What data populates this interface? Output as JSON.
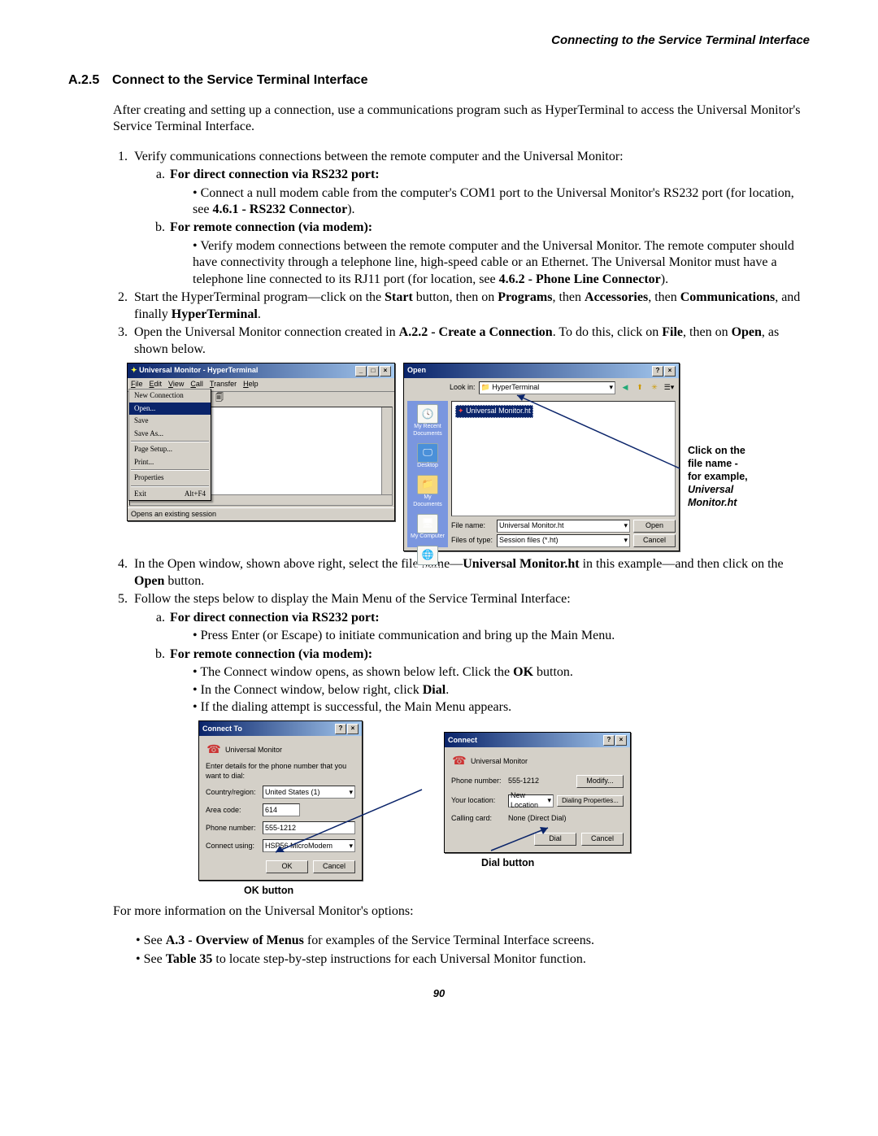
{
  "header": "Connecting to the Service Terminal Interface",
  "section": {
    "num": "A.2.5",
    "title": "Connect to the Service Terminal Interface"
  },
  "intro": "After creating and setting up a connection, use a communications program such as HyperTerminal to access the Universal Monitor's Service Terminal Interface.",
  "steps": {
    "s1": "Verify communications connections between the remote computer and the Universal Monitor:",
    "s1a_label": "For direct connection via RS232 port:",
    "s1a_b1a": "Connect a null modem cable from the computer's COM1 port to the Universal Monitor's RS232 port (for location, see ",
    "s1a_b1b": "4.6.1 - RS232 Connector",
    "s1a_b1c": ").",
    "s1b_label": "For remote connection (via modem):",
    "s1b_b1a": "Verify modem connections between the remote computer and the Universal Monitor. The remote computer should have connectivity through a telephone line, high-speed cable or an Ethernet. The Universal Monitor must have a telephone line connected to its RJ11 port (for location, see ",
    "s1b_b1b": "4.6.2 - Phone Line Connector",
    "s1b_b1c": ").",
    "s2a": "Start the HyperTerminal program—click on the ",
    "s2b": "Start",
    "s2c": " button, then on ",
    "s2d": "Programs",
    "s2e": ", then ",
    "s2f": "Accessories",
    "s2g": ", then ",
    "s2h": "Communications",
    "s2i": ", and finally ",
    "s2j": "HyperTerminal",
    "s2k": ".",
    "s3a": "Open the Universal Monitor connection created in ",
    "s3b": "A.2.2 - Create a Connection",
    "s3c": ". To do this, click on ",
    "s3d": "File",
    "s3e": ", then on ",
    "s3f": "Open",
    "s3g": ", as shown below.",
    "s4a": "In the Open window, shown above right, select the file name—",
    "s4b": "Universal Monitor.ht",
    "s4c": " in this example—and then click on the ",
    "s4d": "Open",
    "s4e": " button.",
    "s5": "Follow the steps below to display the Main Menu of the Service Terminal Interface:",
    "s5a_label": "For direct connection via RS232 port:",
    "s5a_b1": "Press Enter (or Escape) to initiate communication and bring up the Main Menu.",
    "s5b_label": "For remote connection (via modem):",
    "s5b_b1a": "The Connect window opens, as shown below left. Click the ",
    "s5b_b1b": "OK",
    "s5b_b1c": " button.",
    "s5b_b2a": "In the Connect window, below right, click ",
    "s5b_b2b": "Dial",
    "s5b_b2c": ".",
    "s5b_b3": "If the dialing attempt is successful, the Main Menu appears."
  },
  "post": "For more information on the Universal Monitor's options:",
  "ref1a": "See ",
  "ref1b": "A.3 - Overview of Menus",
  "ref1c": " for examples of the Service Terminal Interface screens.",
  "ref2a": "See ",
  "ref2b": "Table 35",
  "ref2c": " to locate step-by-step instructions for each Universal Monitor function.",
  "page_num": "90",
  "ht": {
    "title": "Universal Monitor - HyperTerminal",
    "menu": {
      "file": "File",
      "edit": "Edit",
      "view": "View",
      "call": "Call",
      "transfer": "Transfer",
      "help": "Help"
    },
    "filemenu": {
      "new": "New Connection",
      "open": "Open...",
      "save": "Save",
      "saveas": "Save As...",
      "pagesetup": "Page Setup...",
      "print": "Print...",
      "properties": "Properties",
      "exit": "Exit",
      "exit_sc": "Alt+F4"
    },
    "status": "Opens an existing session"
  },
  "opendlg": {
    "title": "Open",
    "lookin_label": "Look in:",
    "lookin_value": "HyperTerminal",
    "places": {
      "recent": "My Recent Documents",
      "desktop": "Desktop",
      "mydocs": "My Documents",
      "mycomp": "My Computer",
      "netplaces": "My Network Places"
    },
    "file": "Universal Monitor.ht",
    "filename_label": "File name:",
    "filename_value": "Universal Monitor.ht",
    "type_label": "Files of type:",
    "type_value": "Session files (*.ht)",
    "open_btn": "Open",
    "cancel_btn": "Cancel"
  },
  "side_annot": {
    "l1": "Click on the",
    "l2": "file name -",
    "l3": "for example,",
    "l4": "Universal",
    "l5": "Monitor.ht"
  },
  "connectto": {
    "title": "Connect To",
    "name": "Universal Monitor",
    "prompt": "Enter details for the phone number that you want to dial:",
    "country_label": "Country/region:",
    "country_value": "United States (1)",
    "area_label": "Area code:",
    "area_value": "614",
    "phone_label": "Phone number:",
    "phone_value": "555-1212",
    "using_label": "Connect using:",
    "using_value": "HSP56 MicroModem",
    "ok": "OK",
    "cancel": "Cancel"
  },
  "connectd": {
    "title": "Connect",
    "name": "Universal Monitor",
    "phone_label": "Phone number:",
    "phone_value": "555-1212",
    "modify": "Modify...",
    "loc_label": "Your location:",
    "loc_value": "New Location",
    "dprops": "Dialing Properties...",
    "card_label": "Calling card:",
    "card_value": "None (Direct Dial)",
    "dial": "Dial",
    "cancel": "Cancel"
  },
  "annot": {
    "ok": "OK button",
    "dial": "Dial button"
  }
}
